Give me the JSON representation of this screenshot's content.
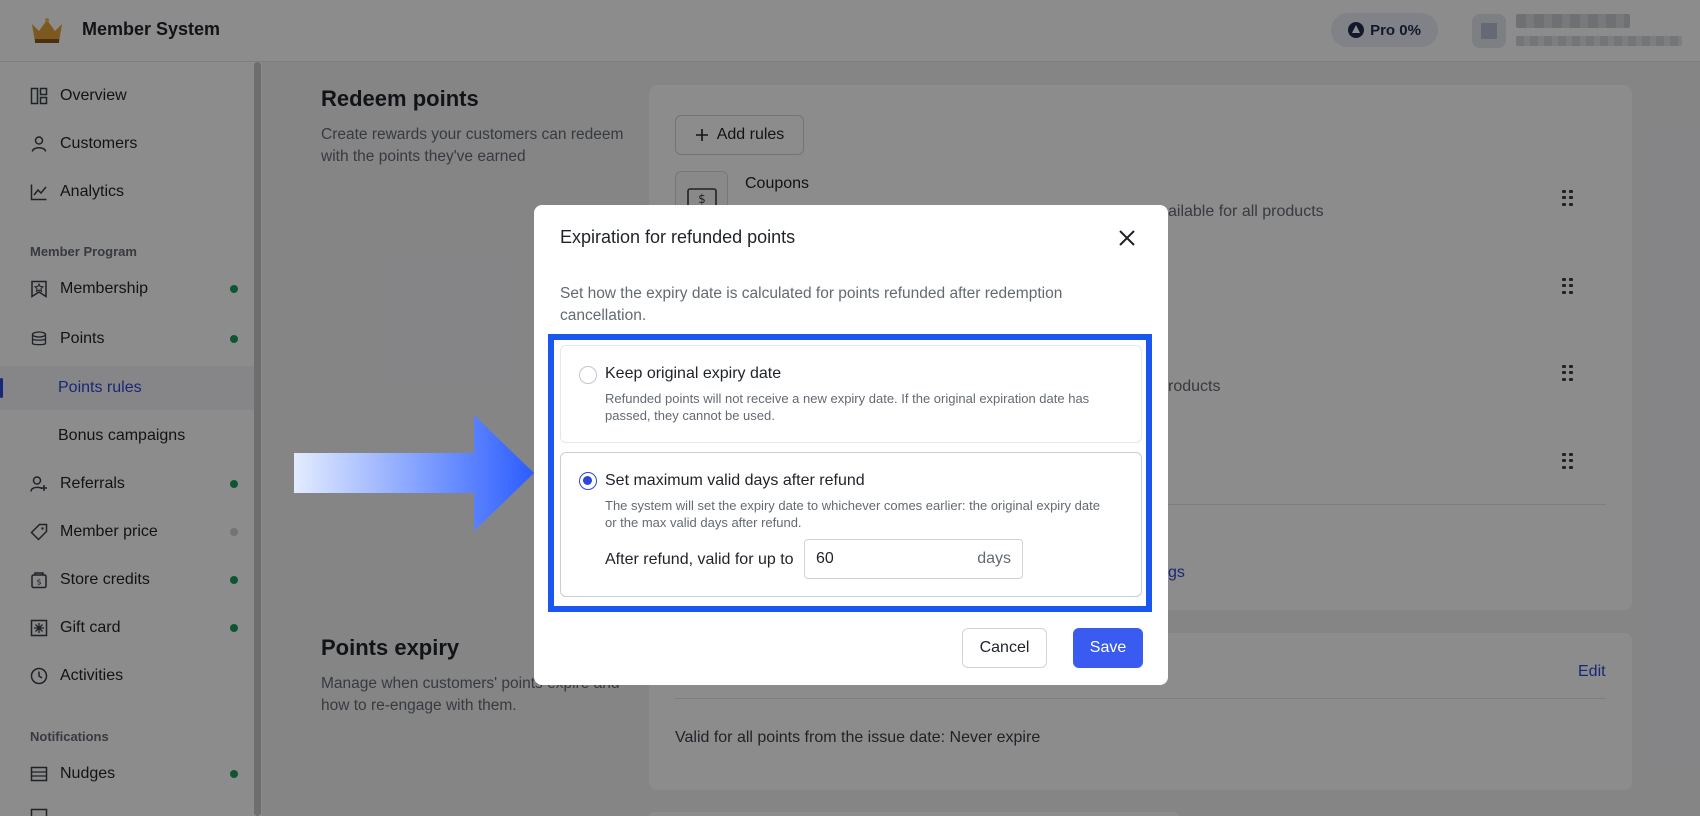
{
  "app": {
    "title": "Member System",
    "plan_badge": "Pro 0%"
  },
  "sidebar": {
    "items": [
      {
        "label": "Overview",
        "icon": "layout-icon"
      },
      {
        "label": "Customers",
        "icon": "user-icon"
      },
      {
        "label": "Analytics",
        "icon": "chart-icon"
      }
    ],
    "member_program_title": "Member Program",
    "program_items": [
      {
        "label": "Membership",
        "icon": "badge-icon",
        "status": "active"
      },
      {
        "label": "Points",
        "icon": "coins-icon",
        "status": "active"
      },
      {
        "label": "Points rules",
        "sub": true,
        "active": true
      },
      {
        "label": "Bonus campaigns",
        "sub": true
      },
      {
        "label": "Referrals",
        "icon": "user-plus-icon",
        "status": "active"
      },
      {
        "label": "Member price",
        "icon": "tag-icon",
        "status": "inactive"
      },
      {
        "label": "Store credits",
        "icon": "wallet-icon",
        "status": "active"
      },
      {
        "label": "Gift card",
        "icon": "gift-card-icon",
        "status": "active"
      },
      {
        "label": "Activities",
        "icon": "clock-icon"
      }
    ],
    "notifications_title": "Notifications",
    "notification_items": [
      {
        "label": "Nudges",
        "icon": "inbox-icon",
        "status": "active"
      }
    ]
  },
  "redeem": {
    "title": "Redeem points",
    "description": "Create rewards your customers can redeem with the points they've earned",
    "add_rules_label": "Add rules",
    "rules": [
      {
        "name": "Coupons",
        "desc_fragment": "ailable for all products"
      },
      {
        "desc_fragment": "roducts"
      }
    ],
    "link_fragment": "gs"
  },
  "expiry": {
    "title": "Points expiry",
    "description": "Manage when customers' points expire and how to re-engage with them.",
    "edit_label": "Edit",
    "summary": "Valid for all points from the issue date: Never expire"
  },
  "modal": {
    "title": "Expiration for refunded points",
    "description": "Set how the expiry date is calculated for points refunded after redemption cancellation.",
    "options": [
      {
        "title": "Keep original expiry date",
        "description": "Refunded points will not receive a new expiry date. If the original expiration date has passed, they cannot be used.",
        "selected": false
      },
      {
        "title": "Set maximum valid days after refund",
        "description": "The system will set the expiry date to whichever comes earlier: the original expiry date or the max valid days after refund.",
        "selected": true
      }
    ],
    "days_label": "After refund, valid for up to",
    "days_value": "60",
    "days_suffix": "days",
    "cancel_label": "Cancel",
    "save_label": "Save"
  },
  "colors": {
    "accent": "#3a5bf0",
    "link": "#2c47d9",
    "highlight": "#1a56f0",
    "status_active": "#1a9c5b"
  }
}
